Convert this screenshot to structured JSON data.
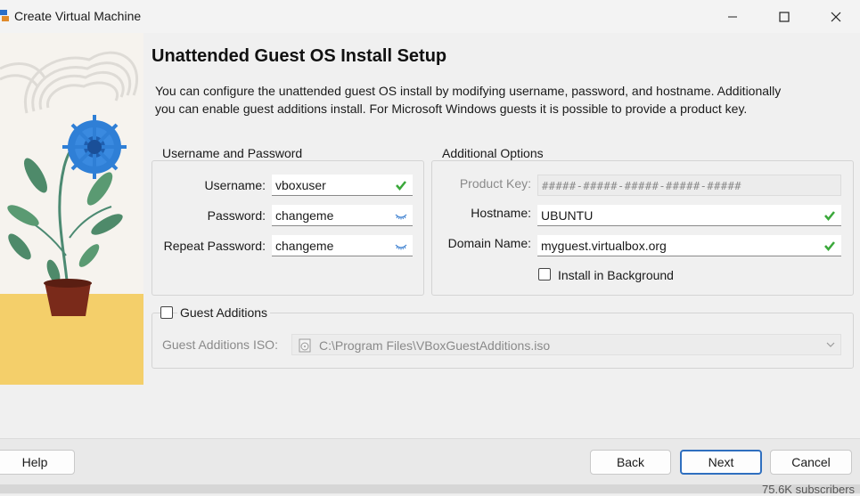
{
  "window": {
    "title": "Create Virtual Machine"
  },
  "page": {
    "heading": "Unattended Guest OS Install Setup",
    "description": "You can configure the unattended guest OS install by modifying username, password, and hostname. Additionally you can enable guest additions install. For Microsoft Windows guests it is possible to provide a product key."
  },
  "credentials": {
    "group_title": "Username and Password",
    "username_label": "Username:",
    "username_value": "vboxuser",
    "password_label": "Password:",
    "password_value": "changeme",
    "repeat_label": "Repeat Password:",
    "repeat_value": "changeme"
  },
  "options": {
    "group_title": "Additional Options",
    "product_key_label": "Product Key:",
    "product_key_value": "#####-#####-#####-#####-#####",
    "hostname_label": "Hostname:",
    "hostname_value": "UBUNTU",
    "domain_label": "Domain Name:",
    "domain_value": "myguest.virtualbox.org",
    "install_bg_label": "Install in Background",
    "install_bg_checked": false
  },
  "guest_additions": {
    "label": "Guest Additions",
    "checked": false,
    "iso_label": "Guest Additions ISO:",
    "iso_path": "C:\\Program Files\\VBoxGuestAdditions.iso"
  },
  "buttons": {
    "help": "Help",
    "back": "Back",
    "next": "Next",
    "cancel": "Cancel"
  },
  "background": {
    "partial_text": "75.6K subscribers"
  },
  "colors": {
    "accent": "#2f6fbf",
    "valid_check": "#3aa83a",
    "flower_blue": "#2f7fd6",
    "pot": "#7a2a1a",
    "floor_yellow": "#f4cf6a"
  }
}
